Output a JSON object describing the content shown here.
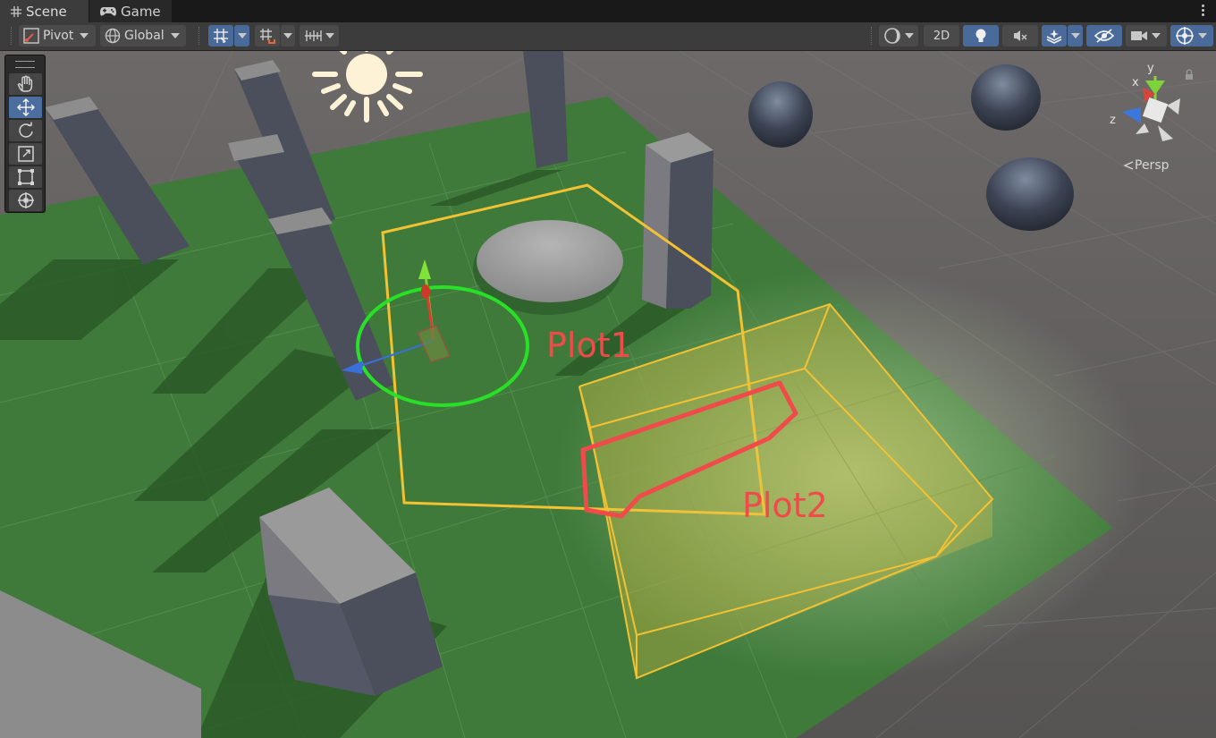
{
  "tabs": [
    {
      "label": "Scene",
      "icon": "grid-icon",
      "active": true
    },
    {
      "label": "Game",
      "icon": "gamepad-icon",
      "active": false
    }
  ],
  "toolbar": {
    "pivot_label": "Pivot",
    "global_label": "Global",
    "mode_2d_label": "2D"
  },
  "gizmo": {
    "y_label": "y",
    "x_label": "x",
    "z_label": "z",
    "projection_label": "Persp"
  },
  "annotations": {
    "plot1": "Plot1",
    "plot2": "Plot2"
  },
  "tools": [
    "hand-tool",
    "move-tool",
    "rotate-tool",
    "scale-tool",
    "rect-tool",
    "transform-tool"
  ],
  "colors": {
    "highlight_outline": "#f04a4a",
    "volume_outline": "#f2c233",
    "ground": "#3f7a3a",
    "selection_blue": "#4a6b99"
  }
}
